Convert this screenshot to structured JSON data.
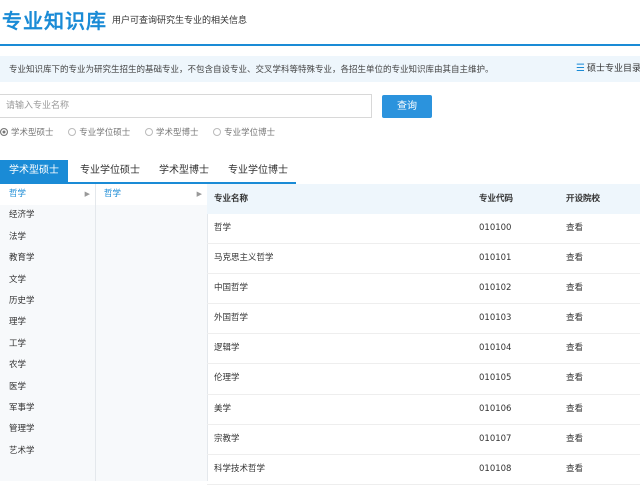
{
  "header": {
    "title": "专业知识库",
    "subtitle": "用户可查询研究生专业的相关信息"
  },
  "notice": {
    "text": "专业知识库下的专业为研究生招生的基础专业，不包含自设专业、交叉学科等特殊专业，各招生单位的专业知识库由其自主维护。",
    "link_label": "硕士专业目录"
  },
  "search": {
    "placeholder": "请输入专业名称",
    "button_label": "查询"
  },
  "radios": [
    {
      "label": "学术型硕士",
      "checked": true
    },
    {
      "label": "专业学位硕士",
      "checked": false
    },
    {
      "label": "学术型博士",
      "checked": false
    },
    {
      "label": "专业学位博士",
      "checked": false
    }
  ],
  "tabs": [
    {
      "label": "学术型硕士",
      "active": true
    },
    {
      "label": "专业学位硕士",
      "active": false
    },
    {
      "label": "学术型博士",
      "active": false
    },
    {
      "label": "专业学位博士",
      "active": false
    }
  ],
  "categories": [
    "哲学",
    "经济学",
    "法学",
    "教育学",
    "文学",
    "历史学",
    "理学",
    "工学",
    "农学",
    "医学",
    "军事学",
    "管理学",
    "艺术学"
  ],
  "selected_category": "哲学",
  "subcategories": [
    "哲学"
  ],
  "table": {
    "headers": [
      "专业名称",
      "专业代码",
      "开设院校"
    ],
    "rows": [
      {
        "name": "哲学",
        "code": "010100",
        "action": "查看"
      },
      {
        "name": "马克思主义哲学",
        "code": "010101",
        "action": "查看"
      },
      {
        "name": "中国哲学",
        "code": "010102",
        "action": "查看"
      },
      {
        "name": "外国哲学",
        "code": "010103",
        "action": "查看"
      },
      {
        "name": "逻辑学",
        "code": "010104",
        "action": "查看"
      },
      {
        "name": "伦理学",
        "code": "010105",
        "action": "查看"
      },
      {
        "name": "美学",
        "code": "010106",
        "action": "查看"
      },
      {
        "name": "宗教学",
        "code": "010107",
        "action": "查看"
      },
      {
        "name": "科学技术哲学",
        "code": "010108",
        "action": "查看"
      }
    ]
  },
  "icons": {
    "list_icon": "list-icon",
    "arrow_icon": "chevron-right-icon"
  },
  "colors": {
    "accent": "#1a8bd6",
    "button": "#2b93dd",
    "notice_bg": "#eef6fc"
  }
}
